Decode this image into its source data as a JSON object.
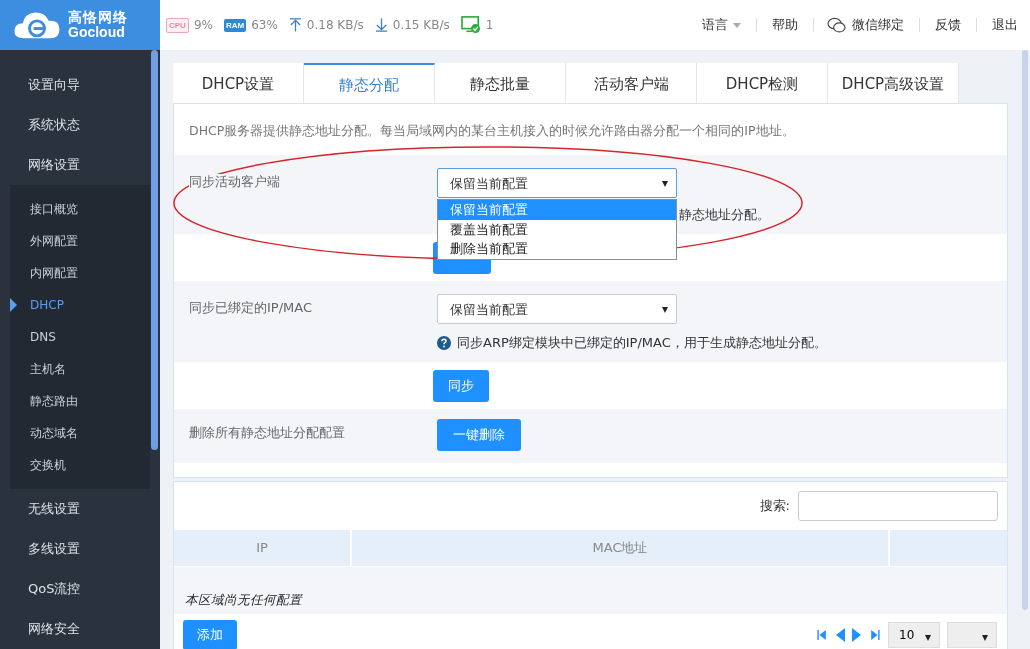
{
  "header": {
    "brand": "高恪网络",
    "brand_latin": "Gocloud",
    "stats": {
      "cpu_label": "CPU",
      "cpu": "9%",
      "ram_label": "RAM",
      "ram": "63%",
      "upload": "0.18 KB/s",
      "download": "0.15 KB/s",
      "devices": "1"
    },
    "nav": [
      {
        "label": "语言",
        "kind": "dropdown"
      },
      {
        "label": "帮助",
        "kind": "link"
      },
      {
        "label": "微信绑定",
        "kind": "wechat"
      },
      {
        "label": "反馈",
        "kind": "link"
      },
      {
        "label": "退出",
        "kind": "link"
      }
    ]
  },
  "sidebar": {
    "items": [
      {
        "label": "设置向导"
      },
      {
        "label": "系统状态"
      },
      {
        "label": "网络设置",
        "children": [
          {
            "label": "接口概览",
            "selected": false
          },
          {
            "label": "外网配置",
            "selected": false
          },
          {
            "label": "内网配置",
            "selected": false
          },
          {
            "label": "DHCP",
            "selected": true
          },
          {
            "label": "DNS",
            "selected": false
          },
          {
            "label": "主机名",
            "selected": false
          },
          {
            "label": "静态路由",
            "selected": false
          },
          {
            "label": "动态域名",
            "selected": false
          },
          {
            "label": "交换机",
            "selected": false
          }
        ]
      },
      {
        "label": "无线设置"
      },
      {
        "label": "多线设置"
      },
      {
        "label": "QoS流控"
      },
      {
        "label": "网络安全"
      }
    ]
  },
  "tabs": [
    {
      "label": "DHCP设置",
      "selected": false
    },
    {
      "label": "静态分配",
      "selected": true
    },
    {
      "label": "静态批量",
      "selected": false
    },
    {
      "label": "活动客户端",
      "selected": false
    },
    {
      "label": "DHCP检测",
      "selected": false
    },
    {
      "label": "DHCP高级设置",
      "selected": false
    }
  ],
  "description": "DHCP服务器提供静态地址分配。每当局域网内的某台主机接入的时候允许路由器分配一个相同的IP地址。",
  "sync_rows": [
    {
      "label": "同步活动客户端",
      "select": {
        "value": "保留当前配置",
        "open": true,
        "options": [
          {
            "label": "保留当前配置",
            "selected": true
          },
          {
            "label": "覆盖当前配置",
            "selected": false
          },
          {
            "label": "删除当前配置",
            "selected": false
          }
        ]
      },
      "hint": "静态地址分配。"
    },
    {
      "label": "同步已绑定的IP/MAC",
      "select": {
        "value": "保留当前配置",
        "open": false
      },
      "hint": "同步ARP绑定模块中已绑定的IP/MAC，用于生成静态地址分配。",
      "button": "同步"
    }
  ],
  "delete_row": {
    "label": "删除所有静态地址分配配置",
    "button": "一键删除"
  },
  "table": {
    "search_label": "搜索:",
    "columns": [
      "IP",
      "MAC地址"
    ],
    "empty_message": "本区域尚无任何配置",
    "add_button": "添加",
    "page_size": "10"
  }
}
